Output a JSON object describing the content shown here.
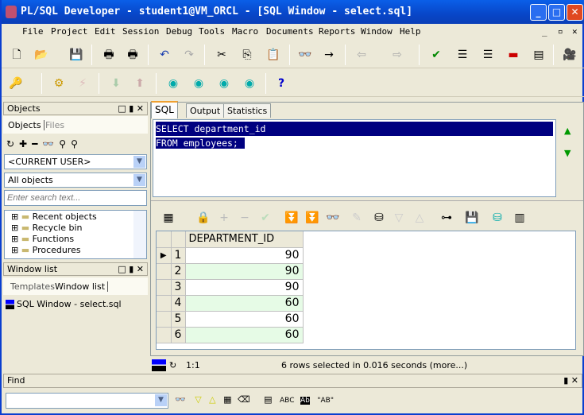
{
  "title": "PL/SQL Developer - student1@VM_ORCL - [SQL Window - select.sql]",
  "menu": [
    "File",
    "Project",
    "Edit",
    "Session",
    "Debug",
    "Tools",
    "Macro",
    "Documents",
    "Reports",
    "Window",
    "Help"
  ],
  "objects_panel": {
    "title": "Objects",
    "tabs": [
      "Objects",
      "Files"
    ],
    "user_combo": "<CURRENT USER>",
    "type_combo": "All objects",
    "search_placeholder": "Enter search text...",
    "tree": [
      "Recent objects",
      "Recycle bin",
      "Functions",
      "Procedures"
    ]
  },
  "window_list": {
    "title": "Window list",
    "tabs": [
      "Templates",
      "Window list"
    ],
    "items": [
      "SQL Window - select.sql"
    ]
  },
  "editor": {
    "tabs": [
      "SQL",
      "Output",
      "Statistics"
    ],
    "lines": [
      "SELECT department_id",
      "FROM employees;"
    ]
  },
  "grid": {
    "column": "DEPARTMENT_ID",
    "rows": [
      {
        "n": "1",
        "v": "90"
      },
      {
        "n": "2",
        "v": "90"
      },
      {
        "n": "3",
        "v": "90"
      },
      {
        "n": "4",
        "v": "60"
      },
      {
        "n": "5",
        "v": "60"
      },
      {
        "n": "6",
        "v": "60"
      }
    ]
  },
  "status": {
    "position": "1:1",
    "message": "6 rows selected in 0.016 seconds (more...)"
  },
  "find": {
    "title": "Find",
    "value": "",
    "labels": {
      "abc": "ABC",
      "quoted": "\"AB\""
    }
  },
  "colors": {
    "title_bar": "#0846c8",
    "selection": "#000080",
    "alt_row": "#e6fbe6"
  }
}
